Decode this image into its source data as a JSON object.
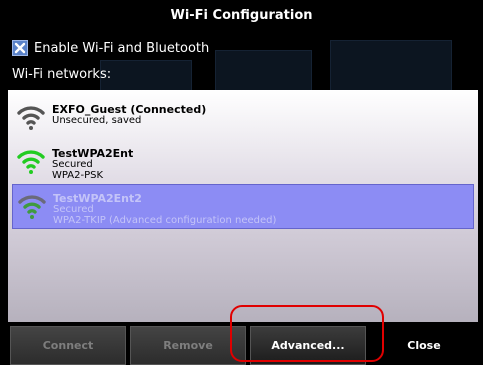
{
  "dialog": {
    "title": "Wi-Fi Configuration"
  },
  "enable": {
    "label": "Enable Wi-Fi and Bluetooth",
    "checked": true
  },
  "networks_label": "Wi-Fi networks:",
  "networks": [
    {
      "name": "EXFO_Guest (Connected)",
      "line1": "Unsecured, saved",
      "line2": "",
      "signal_icon": "wifi-signal-gray-icon",
      "signal_color": "#555555",
      "selected": false
    },
    {
      "name": "TestWPA2Ent",
      "line1": "Secured",
      "line2": "WPA2-PSK",
      "signal_icon": "wifi-signal-green-icon",
      "signal_color": "#22cc22",
      "selected": false
    },
    {
      "name": "TestWPA2Ent2",
      "line1": "Secured",
      "line2": "WPA2-TKIP (Advanced configuration needed)",
      "signal_icon": "wifi-signal-gray-green-icon",
      "signal_color": "#4a8a4a",
      "selected": true
    }
  ],
  "buttons": {
    "connect": "Connect",
    "remove": "Remove",
    "advanced": "Advanced...",
    "close": "Close"
  },
  "colors": {
    "selection": "#8c8cf4",
    "highlight_ring": "#e00000",
    "wifi_green": "#22cc22",
    "wifi_gray": "#555555"
  }
}
